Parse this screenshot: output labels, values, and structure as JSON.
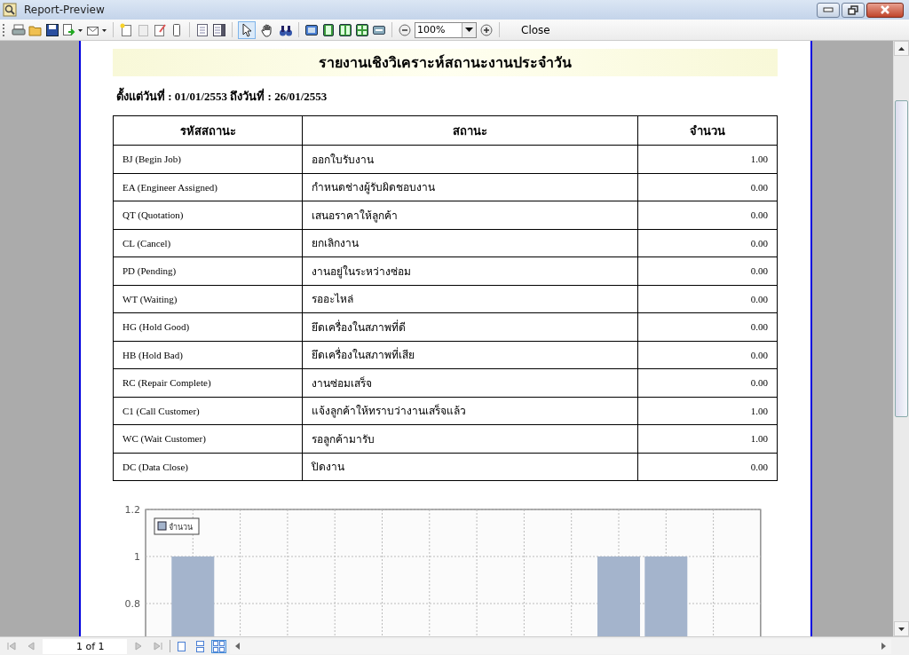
{
  "window": {
    "title": "Report-Preview"
  },
  "toolbar": {
    "zoom": "100%",
    "close": "Close",
    "tools": [
      {
        "kind": "pointer",
        "selected": true
      },
      {
        "kind": "hand",
        "selected": false
      }
    ]
  },
  "report": {
    "title": "รายงานเชิงวิเคราะห์สถานะงานประจำวัน",
    "date_range": "ตั้งแต่วันที่ : 01/01/2553 ถึงวันที่ : 26/01/2553",
    "table": {
      "columns": [
        "รหัสสถานะ",
        "สถานะ",
        "จำนวน"
      ],
      "rows": [
        [
          "BJ (Begin Job)",
          "ออกใบรับงาน",
          "1.00"
        ],
        [
          "EA (Engineer Assigned)",
          "กำหนดช่างผู้รับผิดชอบงาน",
          "0.00"
        ],
        [
          "QT (Quotation)",
          "เสนอราคาให้ลูกค้า",
          "0.00"
        ],
        [
          "CL (Cancel)",
          "ยกเลิกงาน",
          "0.00"
        ],
        [
          "PD (Pending)",
          "งานอยู่ในระหว่างซ่อม",
          "0.00"
        ],
        [
          "WT (Waiting)",
          "รออะไหล่",
          "0.00"
        ],
        [
          "HG (Hold Good)",
          "ยึดเครื่องในสภาพที่ดี",
          "0.00"
        ],
        [
          "HB (Hold Bad)",
          "ยึดเครื่องในสภาพที่เสีย",
          "0.00"
        ],
        [
          "RC (Repair Complete)",
          "งานซ่อมเสร็จ",
          "0.00"
        ],
        [
          "C1 (Call Customer)",
          "แจ้งลูกค้าให้ทราบว่างานเสร็จแล้ว",
          "1.00"
        ],
        [
          "WC (Wait Customer)",
          "รอลูกค้ามารับ",
          "1.00"
        ],
        [
          "DC (Data Close)",
          "ปิดงาน",
          "0.00"
        ]
      ]
    },
    "chart_data": {
      "type": "bar",
      "ylim": [
        0,
        1.2
      ],
      "grid": true,
      "yticks": [
        {
          "value": 0.8,
          "label": "0.8"
        },
        {
          "value": 1,
          "label": "1"
        },
        {
          "value": 1.2,
          "label": "1.2"
        }
      ],
      "series": [
        {
          "name": "จำนวน",
          "color": "#a4b4cc",
          "values": [
            1,
            0,
            0,
            0,
            0,
            0,
            0,
            0,
            0,
            1,
            1,
            0
          ]
        }
      ]
    }
  },
  "navigator": {
    "page": "1 of 1",
    "view_modes": [
      {
        "selected": false
      },
      {
        "selected": false
      },
      {
        "selected": true
      }
    ]
  }
}
